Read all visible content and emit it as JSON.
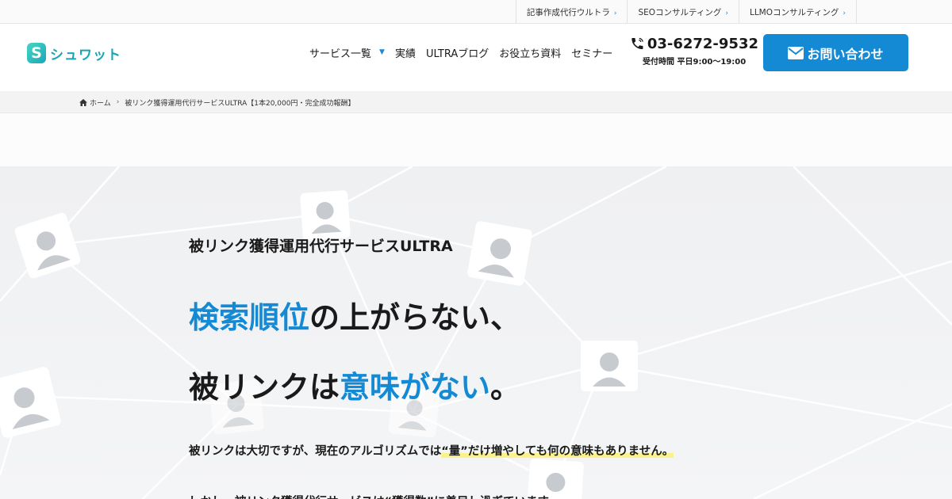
{
  "topbar": {
    "links": [
      {
        "label": "記事作成代行ウルトラ"
      },
      {
        "label": "SEOコンサルティング"
      },
      {
        "label": "LLMOコンサルティング"
      }
    ]
  },
  "header": {
    "logo_mark": "S",
    "logo_text": "シュワット",
    "nav": [
      {
        "label": "サービス一覧"
      },
      {
        "label": "実績"
      },
      {
        "label": "ULTRAブログ"
      },
      {
        "label": "お役立ち資料"
      },
      {
        "label": "セミナー"
      }
    ],
    "phone": {
      "number": "03-6272-9532",
      "hours": "受付時間 平日9:00〜19:00"
    },
    "cta_label": "お問い合わせ"
  },
  "breadcrumb": {
    "home": "ホーム",
    "current": "被リンク獲得運用代行サービスULTRA【1本20,000円・完全成功報酬】"
  },
  "hero": {
    "eyebrow": "被リンク獲得運用代行サービスULTRA",
    "line1_blue": "検索順位",
    "line1_rest": "の上がらない、",
    "line2_a": "被リンクは",
    "line2_blue": "意味がない",
    "line2_end": "。",
    "lead_a": "被リンクは大切ですが、現在のアルゴリズムでは",
    "lead_hl": "“量”だけ増やしても何の意味もありません。",
    "cut_text": "しかし、被リンク獲得代行サービスは“獲得数”に着目し過ぎています。"
  },
  "colors": {
    "accent": "#1489d4",
    "logo": "#17a6b5",
    "highlight": "#fbf28a"
  }
}
